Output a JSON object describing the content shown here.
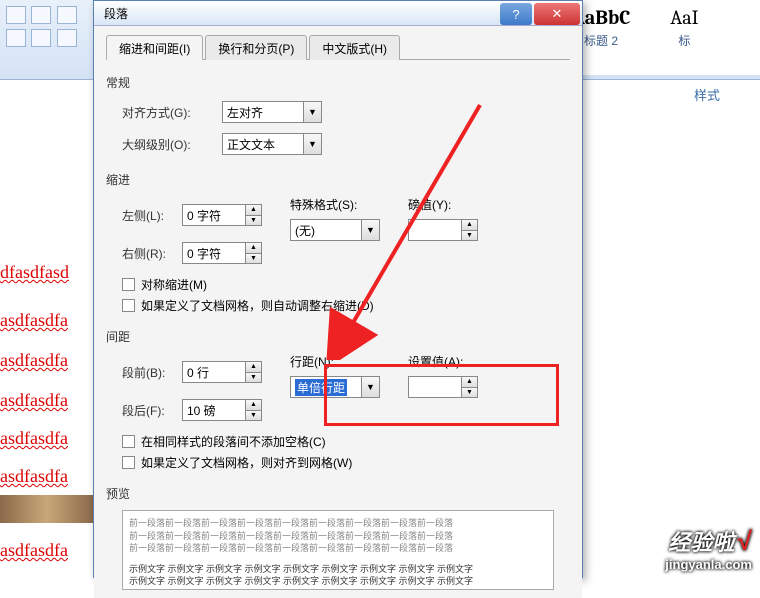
{
  "ribbon": {
    "styles": [
      {
        "preview": "AaBbC",
        "bold": true,
        "label": "标题 2"
      },
      {
        "preview": "AaI",
        "bold": false,
        "label": "标"
      }
    ],
    "caption": "样式"
  },
  "background_text": [
    "dfasdfasd",
    "asdfasdfa",
    "asdfasdfa",
    "asdfasdfa",
    "asdfasdfa",
    "asdfasdfa",
    "asdfasdfa"
  ],
  "dialog": {
    "title": "段落",
    "tabs": [
      {
        "label": "缩进和间距(I)",
        "active": true
      },
      {
        "label": "换行和分页(P)",
        "active": false
      },
      {
        "label": "中文版式(H)",
        "active": false
      }
    ],
    "sections": {
      "general": {
        "title": "常规",
        "align_label": "对齐方式(G):",
        "align_value": "左对齐",
        "outline_label": "大纲级别(O):",
        "outline_value": "正文文本"
      },
      "indent": {
        "title": "缩进",
        "left_label": "左侧(L):",
        "left_value": "0 字符",
        "right_label": "右侧(R):",
        "right_value": "0 字符",
        "special_label": "特殊格式(S):",
        "special_value": "(无)",
        "by_label": "磅值(Y):",
        "by_value": "",
        "mirror_cb": "对称缩进(M)",
        "grid_cb": "如果定义了文档网格，则自动调整右缩进(D)"
      },
      "spacing": {
        "title": "间距",
        "before_label": "段前(B):",
        "before_value": "0 行",
        "after_label": "段后(F):",
        "after_value": "10 磅",
        "line_label": "行距(N):",
        "line_value": "单倍行距",
        "at_label": "设置值(A):",
        "at_value": "",
        "nospace_cb": "在相同样式的段落间不添加空格(C)",
        "snap_cb": "如果定义了文档网格，则对齐到网格(W)"
      },
      "preview": {
        "title": "预览",
        "faint": "前一段落前一段落前一段落前一段落前一段落前一段落前一段落前一段落前一段落",
        "sample": "示例文字 示例文字 示例文字 示例文字 示例文字 示例文字 示例文字 示例文字 示例文字"
      }
    }
  },
  "watermark": {
    "brand": "经验啦",
    "check": "√",
    "url": "jingyanla.com"
  }
}
